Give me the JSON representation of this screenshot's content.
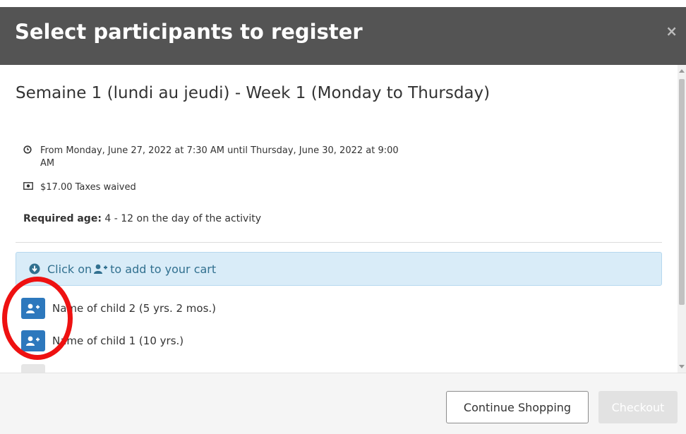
{
  "modal": {
    "title": "Select participants to register",
    "close_label": "×"
  },
  "activity": {
    "title": "Semaine 1 (lundi au jeudi) - Week 1 (Monday to Thursday)",
    "schedule": "From Monday, June 27, 2022 at 7:30 AM until Thursday, June 30, 2022 at 9:00 AM",
    "price": "$17.00 Taxes waived",
    "required_age_label": "Required age:",
    "required_age_value": "4 - 12 on the day of the activity"
  },
  "notice": {
    "prefix": "Click on",
    "suffix": "to add to your cart"
  },
  "participants": [
    {
      "name": "Name of child 2 (5 yrs. 2 mos.)"
    },
    {
      "name": "Name of child 1 (10 yrs.)"
    }
  ],
  "footer": {
    "continue_label": "Continue Shopping",
    "checkout_label": "Checkout"
  },
  "colors": {
    "header_bg": "#545454",
    "primary": "#2d78bd",
    "notice_bg": "#d9ecf8",
    "notice_text": "#31708f",
    "highlight": "#ee1111"
  },
  "icons": {
    "schedule": "clock-icon",
    "price": "money-icon",
    "notice": "arrow-circle-down-icon",
    "add": "user-plus-icon"
  }
}
